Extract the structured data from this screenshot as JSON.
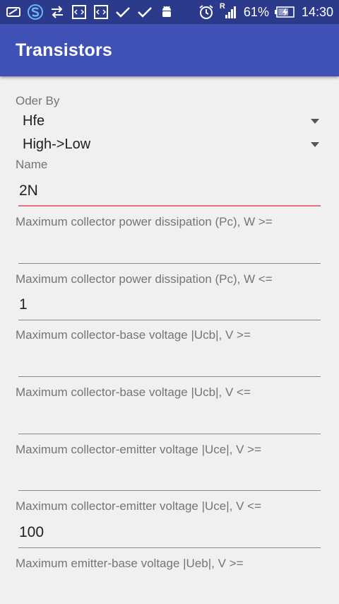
{
  "status_bar": {
    "battery_percent": "61%",
    "time": "14:30",
    "signal_label": "R",
    "icons": [
      "screen-icon",
      "s-app-icon",
      "sync-arrows-icon",
      "code-icon",
      "code-icon",
      "check-icon",
      "check-icon",
      "android-icon",
      "alarm-icon",
      "signal-icon",
      "battery-charging-icon"
    ]
  },
  "app_bar": {
    "title": "Transistors"
  },
  "filters": {
    "order_by_label": "Oder By",
    "order_by_value": "Hfe",
    "direction_value": "High->Low",
    "name_label": "Name",
    "name_value": "2N",
    "pc_min_label": "Maximum collector power dissipation (Pc), W >=",
    "pc_min_value": "",
    "pc_max_label": "Maximum collector power dissipation (Pc), W <=",
    "pc_max_value": "1",
    "ucb_min_label": "Maximum collector-base voltage |Ucb|, V >=",
    "ucb_min_value": "",
    "ucb_max_label": "Maximum collector-base voltage |Ucb|, V <=",
    "ucb_max_value": "",
    "uce_min_label": "Maximum collector-emitter voltage |Uce|, V >=",
    "uce_min_value": "",
    "uce_max_label": "Maximum collector-emitter voltage |Uce|, V <=",
    "uce_max_value": "100",
    "ueb_min_label": "Maximum emitter-base voltage |Ueb|, V >="
  },
  "colors": {
    "status_bar": "#2c3a8c",
    "app_bar": "#3f51b5",
    "focused_underline": "#e57373"
  }
}
